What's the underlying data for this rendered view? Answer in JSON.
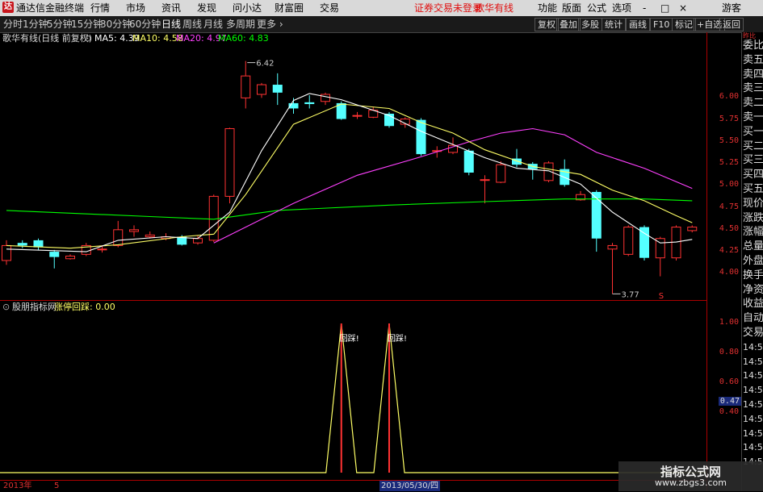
{
  "window": {
    "logo_text": "达",
    "app_title": "通达信金融终端",
    "menu": [
      "行情",
      "市场",
      "资讯",
      "发现",
      "问小达",
      "财富圈",
      "交易"
    ],
    "login_status": "证券交易未登录",
    "stock_name_title": "歌华有线",
    "right_menu": [
      "功能",
      "版面",
      "公式",
      "选项"
    ],
    "guest": "游客",
    "window_buttons": [
      "-",
      "□",
      "×"
    ]
  },
  "tabs": {
    "periods": [
      "分时",
      "1分钟",
      "5分钟",
      "15分钟",
      "30分钟",
      "60分钟",
      "日线",
      "周线",
      "月线",
      "多周期",
      "更多"
    ],
    "active_index": 6,
    "right_buttons": [
      "复权",
      "叠加",
      "多股",
      "统计",
      "画线",
      "F10",
      "标记",
      "+自选",
      "返回"
    ]
  },
  "info": {
    "title": "歌华有线(日线 前复权)",
    "ma": [
      {
        "label": "MA5: 4.39",
        "color": "#ffffff"
      },
      {
        "label": "MA10: 4.58",
        "color": "#ffff66"
      },
      {
        "label": "MA20: 4.97",
        "color": "#ff40ff"
      },
      {
        "label": "MA60: 4.83",
        "color": "#00ff00"
      }
    ]
  },
  "price_axis": [
    "6.00",
    "5.75",
    "5.50",
    "5.25",
    "5.00",
    "4.75",
    "4.50",
    "4.25",
    "4.00"
  ],
  "sub_axis": [
    "1.00",
    "0.80",
    "0.60",
    "0.40"
  ],
  "sub_axis_current": "0.47",
  "main_annotations": {
    "high": "6.42",
    "low": "3.77",
    "marker": "S"
  },
  "sub": {
    "indicator_name": "股朋指标网",
    "signal_label": "涨停回踩: 0.00",
    "peak_label": "回踩!"
  },
  "bottom": {
    "year": "2013年",
    "five": "5",
    "cursor_date": "2013/05/30/四"
  },
  "right_panel": {
    "header_small": "昨比",
    "items": [
      "委比",
      "卖五",
      "卖四",
      "卖三",
      "卖二",
      "卖一",
      "买一",
      "买二",
      "买三",
      "买四",
      "买五",
      "现价",
      "涨跌",
      "涨幅",
      "总量",
      "外盘",
      "换手",
      "净资",
      "收益",
      "自动",
      "交易",
      "14:56",
      "14:56",
      "14:56",
      "14:56",
      "14:56",
      "14:56",
      "14:56",
      "14:56",
      "14:56"
    ]
  },
  "watermark": {
    "title": "指标公式网",
    "url": "www.zbgs3.com"
  },
  "colors": {
    "up": "#ff3232",
    "down": "#54ffff",
    "ma5": "#ffffff",
    "ma10": "#ffff66",
    "ma20": "#ff40ff",
    "ma60": "#00ff00",
    "axis": "#aa0000"
  },
  "candles": [
    {
      "o": 4.15,
      "c": 4.32,
      "h": 4.38,
      "l": 4.1
    },
    {
      "o": 4.35,
      "c": 4.32,
      "h": 4.38,
      "l": 4.29
    },
    {
      "o": 4.38,
      "c": 4.3,
      "h": 4.4,
      "l": 4.27
    },
    {
      "o": 4.25,
      "c": 4.19,
      "h": 4.27,
      "l": 4.06
    },
    {
      "o": 4.17,
      "c": 4.2,
      "h": 4.22,
      "l": 4.16
    },
    {
      "o": 4.22,
      "c": 4.32,
      "h": 4.35,
      "l": 4.2
    },
    {
      "o": 4.28,
      "c": 4.28,
      "h": 4.32,
      "l": 4.24
    },
    {
      "o": 4.32,
      "c": 4.5,
      "h": 4.6,
      "l": 4.3
    },
    {
      "o": 4.48,
      "c": 4.5,
      "h": 4.55,
      "l": 4.42
    },
    {
      "o": 4.42,
      "c": 4.44,
      "h": 4.48,
      "l": 4.4
    },
    {
      "o": 4.4,
      "c": 4.42,
      "h": 4.46,
      "l": 4.38
    },
    {
      "o": 4.42,
      "c": 4.33,
      "h": 4.44,
      "l": 4.32
    },
    {
      "o": 4.35,
      "c": 4.4,
      "h": 4.43,
      "l": 4.33
    },
    {
      "o": 4.38,
      "c": 4.88,
      "h": 4.9,
      "l": 4.36
    },
    {
      "o": 4.88,
      "c": 5.65,
      "h": 5.66,
      "l": 4.8
    },
    {
      "o": 6.0,
      "c": 6.25,
      "h": 6.42,
      "l": 5.88
    },
    {
      "o": 6.04,
      "c": 6.15,
      "h": 6.17,
      "l": 6.0
    },
    {
      "o": 6.15,
      "c": 6.06,
      "h": 6.28,
      "l": 5.92
    },
    {
      "o": 5.94,
      "c": 5.88,
      "h": 6.0,
      "l": 5.82
    },
    {
      "o": 5.95,
      "c": 5.93,
      "h": 6.03,
      "l": 5.88
    },
    {
      "o": 5.96,
      "c": 6.04,
      "h": 6.06,
      "l": 5.92
    },
    {
      "o": 5.94,
      "c": 5.76,
      "h": 5.96,
      "l": 5.75
    },
    {
      "o": 5.8,
      "c": 5.8,
      "h": 5.84,
      "l": 5.76
    },
    {
      "o": 5.78,
      "c": 5.86,
      "h": 5.9,
      "l": 5.77
    },
    {
      "o": 5.82,
      "c": 5.68,
      "h": 5.84,
      "l": 5.66
    },
    {
      "o": 5.7,
      "c": 5.76,
      "h": 5.78,
      "l": 5.66
    },
    {
      "o": 5.75,
      "c": 5.36,
      "h": 5.77,
      "l": 5.34
    },
    {
      "o": 5.4,
      "c": 5.4,
      "h": 5.45,
      "l": 5.32
    },
    {
      "o": 5.38,
      "c": 5.46,
      "h": 5.55,
      "l": 5.36
    },
    {
      "o": 5.4,
      "c": 5.15,
      "h": 5.42,
      "l": 5.12
    },
    {
      "o": 5.07,
      "c": 5.07,
      "h": 5.12,
      "l": 4.8
    },
    {
      "o": 5.04,
      "c": 5.24,
      "h": 5.28,
      "l": 5.03
    },
    {
      "o": 5.31,
      "c": 5.24,
      "h": 5.42,
      "l": 5.21
    },
    {
      "o": 5.25,
      "c": 5.19,
      "h": 5.27,
      "l": 5.07
    },
    {
      "o": 5.06,
      "c": 5.26,
      "h": 5.28,
      "l": 5.04
    },
    {
      "o": 5.19,
      "c": 5.01,
      "h": 5.3,
      "l": 4.99
    },
    {
      "o": 4.84,
      "c": 4.9,
      "h": 4.94,
      "l": 4.83
    },
    {
      "o": 4.93,
      "c": 4.4,
      "h": 4.95,
      "l": 4.25
    },
    {
      "o": 4.28,
      "c": 4.32,
      "h": 4.35,
      "l": 3.77
    },
    {
      "o": 4.22,
      "c": 4.53,
      "h": 4.55,
      "l": 4.2
    },
    {
      "o": 4.53,
      "c": 4.18,
      "h": 4.55,
      "l": 4.15
    },
    {
      "o": 4.18,
      "c": 4.4,
      "h": 4.42,
      "l": 3.97
    },
    {
      "o": 4.18,
      "c": 4.53,
      "h": 4.55,
      "l": 4.15
    },
    {
      "o": 4.49,
      "c": 4.53,
      "h": 4.55,
      "l": 4.47
    }
  ],
  "ma_lines": {
    "ma5": [
      [
        0,
        4.28
      ],
      [
        5,
        4.25
      ],
      [
        7,
        4.38
      ],
      [
        10,
        4.42
      ],
      [
        12,
        4.4
      ],
      [
        14,
        4.7
      ],
      [
        16,
        5.4
      ],
      [
        18,
        5.97
      ],
      [
        19,
        6.05
      ],
      [
        21,
        5.98
      ],
      [
        24,
        5.8
      ],
      [
        26,
        5.62
      ],
      [
        28,
        5.47
      ],
      [
        30,
        5.32
      ],
      [
        32,
        5.2
      ],
      [
        34,
        5.17
      ],
      [
        36,
        5.02
      ],
      [
        38,
        4.7
      ],
      [
        40,
        4.46
      ],
      [
        41,
        4.35
      ],
      [
        42,
        4.36
      ],
      [
        43,
        4.39
      ]
    ],
    "ma10": [
      [
        0,
        4.32
      ],
      [
        4,
        4.29
      ],
      [
        7,
        4.33
      ],
      [
        11,
        4.42
      ],
      [
        13,
        4.45
      ],
      [
        15,
        4.9
      ],
      [
        18,
        5.7
      ],
      [
        21,
        5.93
      ],
      [
        24,
        5.88
      ],
      [
        26,
        5.72
      ],
      [
        28,
        5.6
      ],
      [
        30,
        5.41
      ],
      [
        33,
        5.22
      ],
      [
        36,
        5.13
      ],
      [
        38,
        4.95
      ],
      [
        40,
        4.83
      ],
      [
        42,
        4.66
      ],
      [
        43,
        4.58
      ]
    ],
    "ma20": [
      [
        13,
        4.35
      ],
      [
        18,
        4.8
      ],
      [
        22,
        5.12
      ],
      [
        26,
        5.33
      ],
      [
        29,
        5.5
      ],
      [
        31,
        5.6
      ],
      [
        33,
        5.65
      ],
      [
        35,
        5.58
      ],
      [
        37,
        5.38
      ],
      [
        40,
        5.2
      ],
      [
        43,
        4.97
      ]
    ],
    "ma60": [
      [
        0,
        4.72
      ],
      [
        9,
        4.65
      ],
      [
        13,
        4.62
      ],
      [
        17,
        4.72
      ],
      [
        24,
        4.78
      ],
      [
        30,
        4.82
      ],
      [
        35,
        4.85
      ],
      [
        40,
        4.85
      ],
      [
        43,
        4.83
      ]
    ]
  },
  "signal_peaks": [
    21,
    24
  ]
}
